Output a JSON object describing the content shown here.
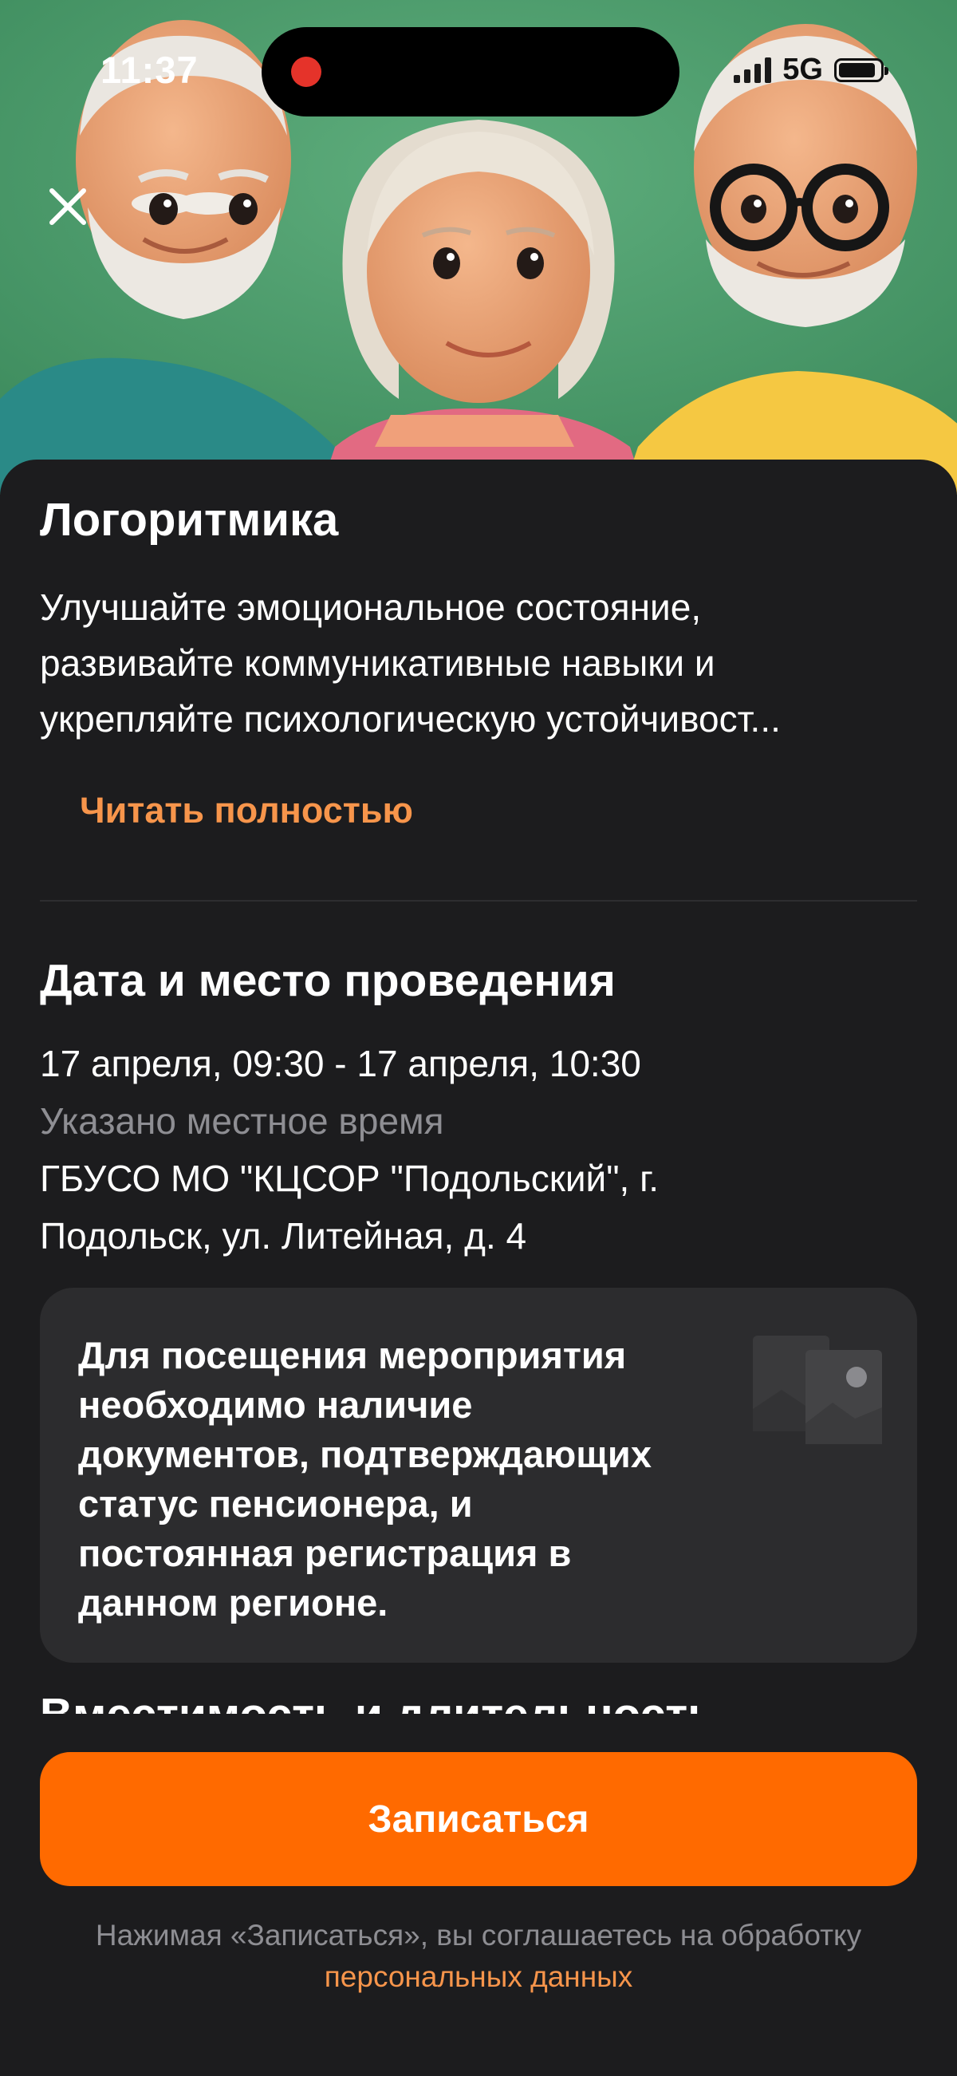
{
  "status_bar": {
    "time": "11:37",
    "network": "5G",
    "signal_bars": 4,
    "battery_level": 0.9
  },
  "header": {
    "close_icon": "close-icon"
  },
  "event": {
    "title": "Логоритмика",
    "description_lines": [
      "Улучшайте эмоциональное состояние,",
      "развивайте коммуникативные навыки и",
      "укрепляйте психологическую устойчивост..."
    ],
    "read_more_label": "Читать полностью"
  },
  "schedule": {
    "section_title": "Дата и место проведения",
    "datetime": "17 апреля, 09:30 - 17 апреля, 10:30",
    "timezone_note": "Указано местное время",
    "address_lines": [
      "ГБУСО МО \"КЦСОР \"Подольский\", г.",
      "Подольск, ул. Литейная, д. 4"
    ]
  },
  "notice": {
    "lines": [
      "Для посещения мероприятия",
      "необходимо наличие",
      "документов, подтверждающих",
      "статус пенсионера, и",
      "постоянная регистрация в",
      "данном регионе."
    ],
    "icon": "documents-icon"
  },
  "capacity": {
    "section_title": "Вместимость и длительность"
  },
  "footer": {
    "signup_label": "Записаться",
    "consent_text": "Нажимая «Записаться», вы соглашаетесь на обработку",
    "consent_link": "персональных данных"
  },
  "colors": {
    "accent": "#ff6a00",
    "link": "#f7954b",
    "background": "#1c1c1e",
    "card": "#2c2c2e",
    "muted_text": "#8e8e93",
    "hero_background": "#4e9a6e"
  }
}
